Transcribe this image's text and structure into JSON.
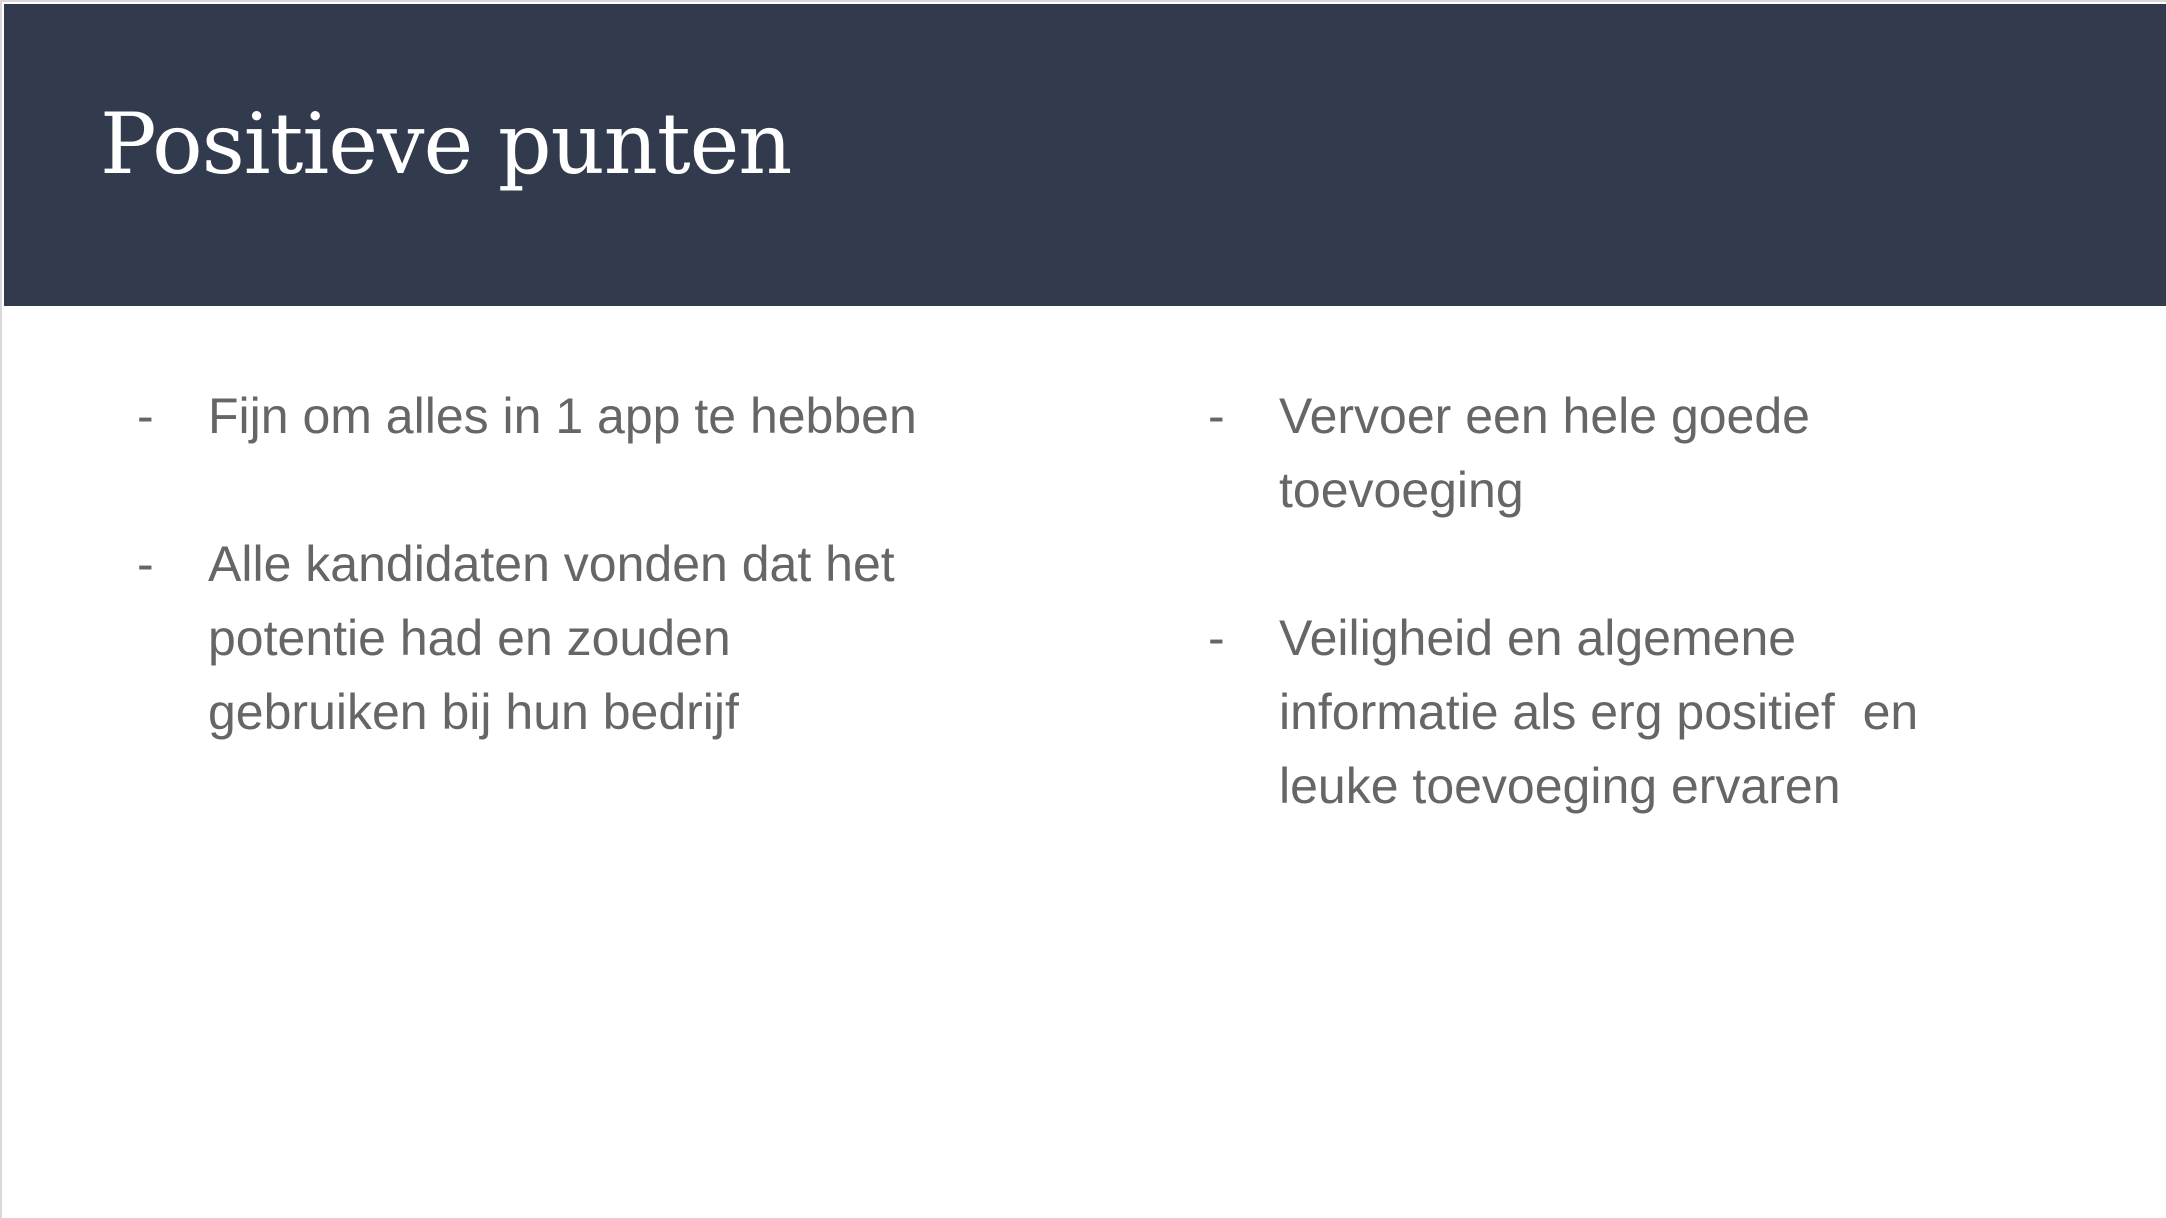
{
  "title": "Positieve punten",
  "colors": {
    "header_bg": "#323a4d",
    "body_text": "#666666"
  },
  "left_column": [
    {
      "bullet": "-",
      "lines": [
        "Fijn om alles in 1 app te hebben"
      ]
    },
    {
      "bullet": "-",
      "lines": [
        "Alle kandidaten vonden dat het",
        "potentie had en zouden",
        "gebruiken bij hun bedrijf"
      ]
    }
  ],
  "right_column": [
    {
      "bullet": "-",
      "lines": [
        "Vervoer een hele goede",
        "toevoeging"
      ]
    },
    {
      "bullet": "-",
      "lines": [
        "Veiligheid en algemene",
        "informatie als erg positief  en",
        "leuke toevoeging ervaren"
      ]
    }
  ]
}
